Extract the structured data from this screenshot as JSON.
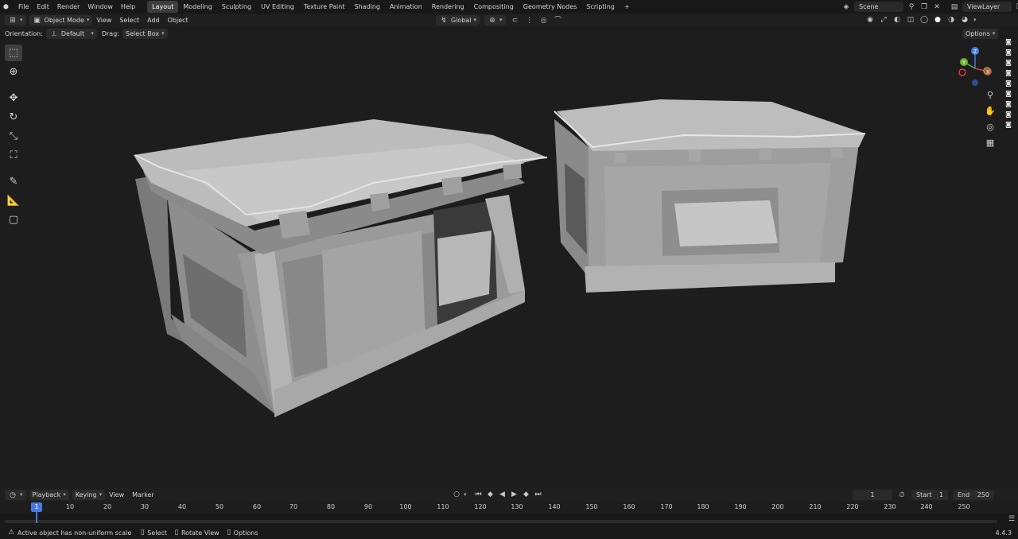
{
  "menubar": {
    "menus": [
      "File",
      "Edit",
      "Render",
      "Window",
      "Help"
    ],
    "workspaces": [
      "Layout",
      "Modeling",
      "Sculpting",
      "UV Editing",
      "Texture Paint",
      "Shading",
      "Animation",
      "Rendering",
      "Compositing",
      "Geometry Nodes",
      "Scripting"
    ],
    "active_workspace": "Layout",
    "add_tab": "+",
    "scene": "Scene",
    "view_layer": "ViewLayer"
  },
  "header": {
    "mode": "Object Mode",
    "menus": [
      "View",
      "Select",
      "Add",
      "Object"
    ],
    "transform_orientation": "Global",
    "options": "Options"
  },
  "tool_settings": {
    "orientation_label": "Orientation:",
    "orientation_value": "Default",
    "drag_label": "Drag:",
    "drag_value": "Select Box"
  },
  "gizmo": {
    "x": "X",
    "y": "Y",
    "z": "Z"
  },
  "timeline": {
    "menus": [
      "Playback",
      "Keying",
      "View",
      "Marker"
    ],
    "current_frame": "1",
    "start_label": "Start",
    "start_value": "1",
    "end_label": "End",
    "end_value": "250",
    "cursor_frame": "1",
    "ticks": [
      "10",
      "20",
      "30",
      "40",
      "50",
      "60",
      "70",
      "80",
      "90",
      "100",
      "110",
      "120",
      "130",
      "140",
      "150",
      "160",
      "170",
      "180",
      "190",
      "200",
      "210",
      "220",
      "230",
      "240",
      "250"
    ]
  },
  "status": {
    "warning": "Active object has non-uniform scale",
    "select": "Select",
    "rotate": "Rotate View",
    "options": "Options",
    "version": "4.4.3"
  },
  "colors": {
    "accent": "#4a78e6",
    "axis_x": "#e0384b",
    "axis_y": "#6cb336",
    "axis_z": "#3d7be8"
  }
}
